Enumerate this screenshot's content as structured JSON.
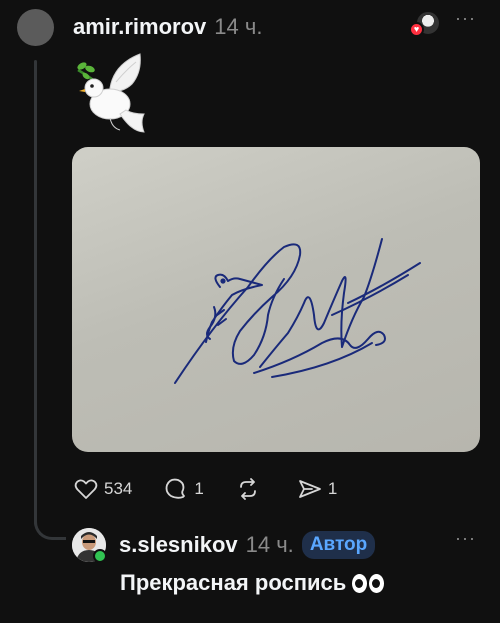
{
  "post": {
    "username": "amir.rimorov",
    "time": "14 ч.",
    "more": "···",
    "emoji": "dove-with-olive-branch",
    "photo": "handwritten signature on paper with woodpecker drawing"
  },
  "actions": {
    "likes": "534",
    "comments": "1",
    "reposts": "",
    "shares": "1"
  },
  "reply": {
    "username": "s.slesnikov",
    "time": "14 ч.",
    "badge": "Автор",
    "more": "···",
    "text": "Прекрасная роспись"
  },
  "colors": {
    "background": "#101010",
    "like_heart": "#ff3040",
    "author_badge_text": "#5aa7ff",
    "online": "#31c452"
  }
}
